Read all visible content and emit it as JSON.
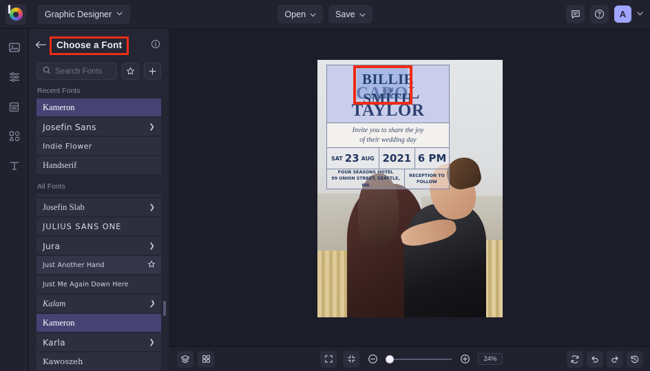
{
  "topbar": {
    "logo_name": "befunky-logo",
    "app_mode": "Graphic Designer",
    "open_label": "Open",
    "save_label": "Save",
    "avatar_initial": "A",
    "chevron": "⌄"
  },
  "rail": {
    "items": [
      {
        "name": "image-tool",
        "icon": "image-icon"
      },
      {
        "name": "adjust-tool",
        "icon": "sliders-icon"
      },
      {
        "name": "templates-tool",
        "icon": "layout-icon"
      },
      {
        "name": "graphics-tool",
        "icon": "shapes-icon"
      },
      {
        "name": "text-tool",
        "icon": "text-icon",
        "glyph": "T"
      }
    ]
  },
  "panel": {
    "title": "Choose a Font",
    "back_icon": "back-arrow-icon",
    "info_icon": "info-icon",
    "highlight_color": "#ef2d16",
    "search": {
      "placeholder": "Search Fonts",
      "value": "",
      "icon": "search-icon"
    },
    "favorites_button": "star-icon",
    "add_button": "plus-icon",
    "recent_label": "Recent Fonts",
    "all_label": "All Fonts",
    "recent_fonts": [
      {
        "label": "Kameron",
        "style": "f-serif",
        "selected": true,
        "arrow": false,
        "star": false
      },
      {
        "label": "Josefin Sans",
        "style": "f-sans",
        "selected": false,
        "arrow": true,
        "star": false
      },
      {
        "label": "Indie Flower",
        "style": "f-hand",
        "selected": false,
        "arrow": false,
        "star": false
      },
      {
        "label": "Handserif",
        "style": "f-serif",
        "selected": false,
        "arrow": false,
        "star": false
      }
    ],
    "all_fonts": [
      {
        "label": "Josefin Slab",
        "style": "f-serif",
        "selected": false,
        "arrow": true,
        "star": false,
        "hovered": false
      },
      {
        "label": "JULIUS SANS ONE",
        "style": "f-caps",
        "selected": false,
        "arrow": false,
        "star": false,
        "hovered": false
      },
      {
        "label": "Jura",
        "style": "f-sans",
        "selected": false,
        "arrow": true,
        "star": false,
        "hovered": false
      },
      {
        "label": "Just Another Hand",
        "style": "f-hand2",
        "selected": false,
        "arrow": false,
        "star": true,
        "hovered": true
      },
      {
        "label": "Just Me Again Down Here",
        "style": "f-hand2",
        "selected": false,
        "arrow": false,
        "star": false,
        "hovered": false
      },
      {
        "label": "Kalam",
        "style": "f-ital",
        "selected": false,
        "arrow": true,
        "star": false,
        "hovered": false
      },
      {
        "label": "Kameron",
        "style": "f-serif",
        "selected": true,
        "arrow": false,
        "star": false,
        "hovered": false
      },
      {
        "label": "Karla",
        "style": "f-sans",
        "selected": false,
        "arrow": true,
        "star": false,
        "hovered": false
      },
      {
        "label": "Kawoszeh",
        "style": "f-mono",
        "selected": false,
        "arrow": false,
        "star": false,
        "hovered": false
      }
    ]
  },
  "canvas": {
    "invitation": {
      "name_first": "BILLIE",
      "name_and": "and",
      "name_second": "SMITH",
      "name_background": "CAROL TAYLOR",
      "message_line1": "Invite you to share the joy",
      "message_line2": "of their wedding day",
      "day": "SAT",
      "date_number": "23",
      "month": "AUG",
      "year": "2021",
      "time": "6 PM",
      "venue_line1": "FOUR SEASONS HOTEL",
      "venue_line2": "99 UNION STREET, SEATTLE, WA",
      "reception_line1": "RECEPTION TO",
      "reception_line2": "FOLLOW"
    }
  },
  "bottombar": {
    "layers_icon": "layers-icon",
    "grid_icon": "grid-icon",
    "fullscreen_icon": "expand-icon",
    "fit_icon": "contract-icon",
    "zoom_out_icon": "minus-circle-icon",
    "zoom_in_icon": "plus-circle-icon",
    "zoom_level": "24%",
    "reset_icon": "refresh-icon",
    "undo_icon": "undo-icon",
    "redo_icon": "redo-icon",
    "history_icon": "history-icon"
  }
}
